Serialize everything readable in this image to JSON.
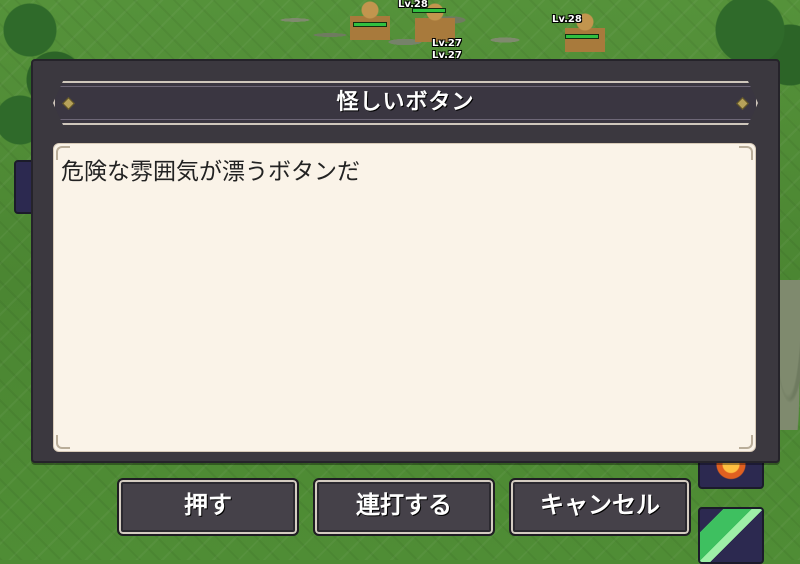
{
  "dialog": {
    "title": "怪しいボタン",
    "description": "危険な雰囲気が漂うボタンだ"
  },
  "buttons": {
    "push": "押す",
    "rapid": "連打する",
    "cancel": "キャンセル"
  },
  "enemies": [
    {
      "level": "Lv.28"
    },
    {
      "level": "Lv.27"
    },
    {
      "level": "Lv.27"
    },
    {
      "level": "Lv.28"
    }
  ],
  "icons": {
    "fire_skill": "fire-skill-icon",
    "leaf_skill": "leaf-skill-icon"
  },
  "colors": {
    "dialog_frame": "#3b383f",
    "body_bg": "#faf3e8",
    "button_bg": "#454149",
    "grass": "#4e8a34"
  }
}
